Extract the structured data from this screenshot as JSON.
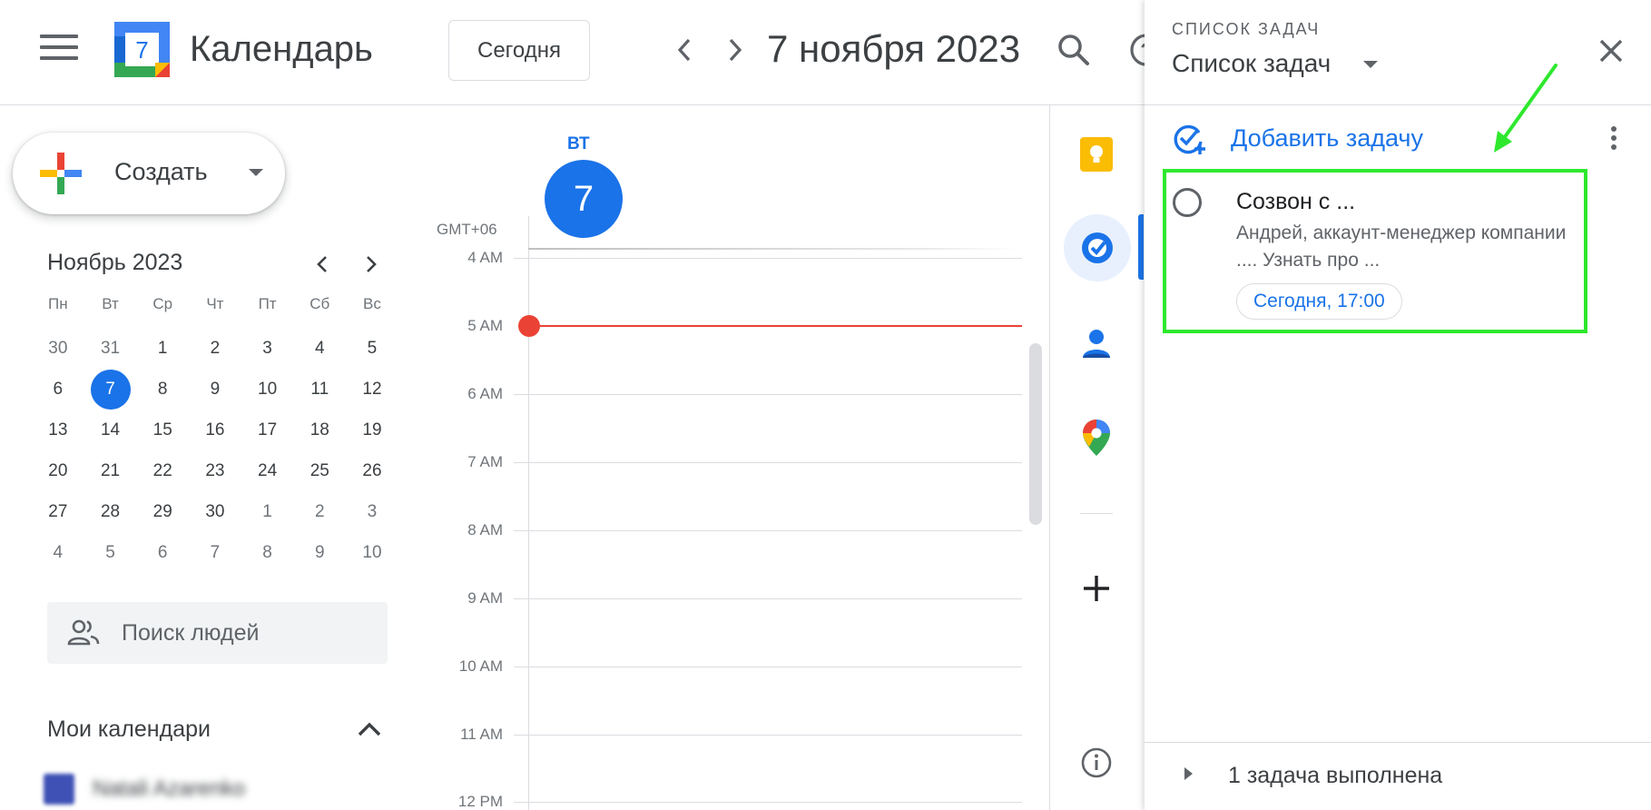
{
  "header": {
    "app_title": "Календарь",
    "logo_day": "7",
    "today_label": "Сегодня",
    "date_title": "7 ноября 2023"
  },
  "sidebar": {
    "create_label": "Создать",
    "mini_calendar": {
      "month_title": "Ноябрь 2023",
      "weekdays": [
        "Пн",
        "Вт",
        "Ср",
        "Чт",
        "Пт",
        "Сб",
        "Вс"
      ],
      "weeks": [
        [
          "30",
          "31",
          "1",
          "2",
          "3",
          "4",
          "5"
        ],
        [
          "6",
          "7",
          "8",
          "9",
          "10",
          "11",
          "12"
        ],
        [
          "13",
          "14",
          "15",
          "16",
          "17",
          "18",
          "19"
        ],
        [
          "20",
          "21",
          "22",
          "23",
          "24",
          "25",
          "26"
        ],
        [
          "27",
          "28",
          "29",
          "30",
          "1",
          "2",
          "3"
        ],
        [
          "4",
          "5",
          "6",
          "7",
          "8",
          "9",
          "10"
        ]
      ],
      "selected": "7"
    },
    "people_search_placeholder": "Поиск людей",
    "my_calendars_title": "Мои календари",
    "calendar_item_name": "Natali Azarenko"
  },
  "day_view": {
    "day_abbr": "ВТ",
    "day_number": "7",
    "timezone": "GMT+06",
    "hours": [
      "4 AM",
      "5 AM",
      "6 AM",
      "7 AM",
      "8 AM",
      "9 AM",
      "10 AM",
      "11 AM",
      "12 PM"
    ]
  },
  "tasks": {
    "kicker": "СПИСОК ЗАДАЧ",
    "list_name": "Список задач",
    "add_task_label": "Добавить задачу",
    "task": {
      "title": "Созвон с ...",
      "notes": "Андрей, аккаунт-менеджер компании .... Узнать про ...",
      "due": "Сегодня, 17:00"
    },
    "completed_label": "1 задача выполнена"
  },
  "colors": {
    "accent": "#1a73e8",
    "now_line": "#ea4335",
    "highlight": "#2ee82e"
  }
}
